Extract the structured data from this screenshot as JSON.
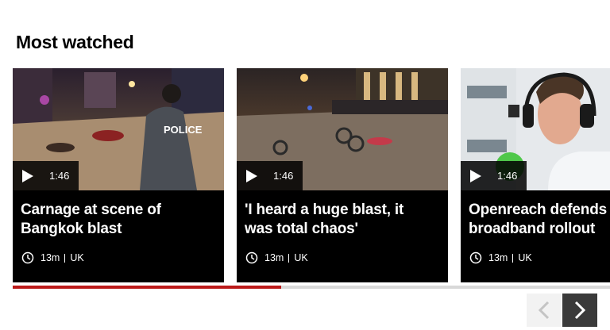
{
  "section": {
    "title": "Most watched"
  },
  "colors": {
    "card_bg": "#000000",
    "accent_progress": "#bb1919",
    "track": "#d8d8d8",
    "nav_prev_bg": "#f2f2f2",
    "nav_next_bg": "#3a3a3a"
  },
  "cards": [
    {
      "headline": "Carnage at scene of\nBangkok blast",
      "duration": "1:46",
      "age": "13m",
      "section": "UK",
      "thumb_icon": "police-officer-scene-image"
    },
    {
      "headline": "'I heard a huge blast, it\nwas total chaos'",
      "duration": "1:46",
      "age": "13m",
      "section": "UK",
      "thumb_icon": "night-street-crowd-image"
    },
    {
      "headline": "Openreach defends\nbroadband rollout",
      "duration": "1:46",
      "age": "13m",
      "section": "UK",
      "thumb_icon": "radio-studio-guest-image"
    }
  ],
  "carousel": {
    "progress_fraction": 0.45
  },
  "nav": {
    "prev_icon": "chevron-left-icon",
    "next_icon": "chevron-right-icon"
  }
}
